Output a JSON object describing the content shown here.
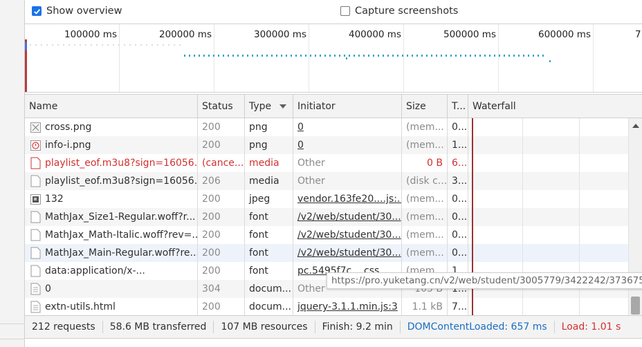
{
  "options": {
    "show_overview_label": "Show overview",
    "capture_screenshots_label": "Capture screenshots"
  },
  "overview": {
    "ticks": [
      "100000 ms",
      "200000 ms",
      "300000 ms",
      "400000 ms",
      "500000 ms",
      "600000 ms",
      "7"
    ]
  },
  "columns": {
    "name": "Name",
    "status": "Status",
    "type": "Type",
    "initiator": "Initiator",
    "size": "Size",
    "time": "T...",
    "waterfall": "Waterfall"
  },
  "rows": [
    {
      "name": "cross.png",
      "icon": "broken-image-icon",
      "status": "200",
      "type": "png",
      "initiator": "0",
      "initiator_link": true,
      "size": "(mem...",
      "time": "0..."
    },
    {
      "name": "info-i.png",
      "icon": "info-image-icon",
      "status": "200",
      "type": "png",
      "initiator": "0",
      "initiator_link": true,
      "size": "(mem...",
      "time": "1..."
    },
    {
      "name": "playlist_eof.m3u8?sign=16056...",
      "icon": "document-icon-red",
      "status": "(cance...",
      "type": "media",
      "initiator": "Other",
      "initiator_link": false,
      "size": "0 B",
      "time": "6...",
      "error": true
    },
    {
      "name": "playlist_eof.m3u8?sign=16056...",
      "icon": "document-icon",
      "status": "206",
      "type": "media",
      "initiator": "Other",
      "initiator_link": false,
      "size": "(disk c...",
      "time": "3..."
    },
    {
      "name": "132",
      "icon": "image-thumbnail-icon",
      "status": "200",
      "type": "jpeg",
      "initiator": "vendor.163fe20....js:...",
      "initiator_link": true,
      "size": "(mem...",
      "time": "0..."
    },
    {
      "name": "MathJax_Size1-Regular.woff?r...",
      "icon": "document-icon",
      "status": "200",
      "type": "font",
      "initiator": "/v2/web/student/30...",
      "initiator_link": true,
      "size": "(mem...",
      "time": "0..."
    },
    {
      "name": "MathJax_Math-Italic.woff?rev=...",
      "icon": "document-icon",
      "status": "200",
      "type": "font",
      "initiator": "/v2/web/student/30...",
      "initiator_link": true,
      "size": "(mem...",
      "time": "0..."
    },
    {
      "name": "MathJax_Main-Regular.woff?re...",
      "icon": "document-icon",
      "status": "200",
      "type": "font",
      "initiator": "/v2/web/student/30...",
      "initiator_link": true,
      "size": "(mem...",
      "time": "0..."
    },
    {
      "name": "data:application/x-...",
      "icon": "document-icon",
      "status": "200",
      "type": "font",
      "initiator": "pc.5495f7c....css",
      "initiator_link": true,
      "size": "(mem...",
      "time": "1..."
    },
    {
      "name": "0",
      "icon": "text-document-icon",
      "status": "304",
      "type": "docum...",
      "initiator": "Other",
      "initiator_link": false,
      "size": "105 B",
      "time": "1..."
    },
    {
      "name": "extn-utils.html",
      "icon": "text-document-icon",
      "status": "200",
      "type": "docum...",
      "initiator": "jquery-3.1.1.min.js:3",
      "initiator_link": true,
      "size": "1.1 kB",
      "time": "7..."
    }
  ],
  "tooltip": "https://pro.yuketang.cn/v2/web/student/3005779/3422242/373675707",
  "summary": {
    "requests": "212 requests",
    "transferred": "58.6 MB transferred",
    "resources": "107 MB resources",
    "finish": "Finish: 9.2 min",
    "dom_content_loaded": "DOMContentLoaded: 657 ms",
    "load": "Load: 1.01 s"
  },
  "colors": {
    "checkbox_checked": "#1a73e8",
    "error_text": "#d32f2f",
    "dcl_text": "#1a6ec2",
    "load_text": "#d32f2f",
    "overview_dots": "#2aa3c9"
  }
}
